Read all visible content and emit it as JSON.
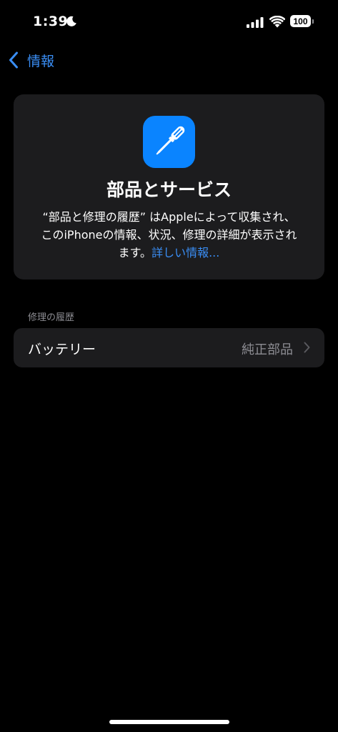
{
  "status_bar": {
    "time": "1:39",
    "battery_level": "100"
  },
  "nav": {
    "back_label": "情報"
  },
  "hero": {
    "title": "部品とサービス",
    "description_line1": "“部品と修理の履歴” はAppleによって収集され、",
    "description_line2": "このiPhoneの情報、状況、修理の詳細が表示され",
    "description_line3": "ます。",
    "link_label": "詳しい情報..."
  },
  "section": {
    "header": "修理の履歴",
    "rows": [
      {
        "label": "バッテリー",
        "value": "純正部品"
      }
    ]
  },
  "colors": {
    "accent": "#3a8ef5",
    "icon_bg": "#0a84ff",
    "card_bg": "#1c1c1e",
    "secondary_text": "#8d8d93"
  }
}
